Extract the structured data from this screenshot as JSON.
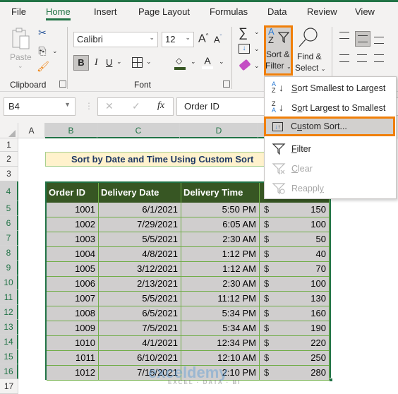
{
  "tabs": [
    {
      "label": "File"
    },
    {
      "label": "Home",
      "active": true
    },
    {
      "label": "Insert"
    },
    {
      "label": "Page Layout"
    },
    {
      "label": "Formulas"
    },
    {
      "label": "Data"
    },
    {
      "label": "Review"
    },
    {
      "label": "View"
    }
  ],
  "ribbon": {
    "clipboard": {
      "paste_label": "Paste",
      "group_label": "Clipboard"
    },
    "font": {
      "font_name": "Calibri",
      "font_size": "12",
      "bold": "B",
      "italic": "I",
      "underline": "U",
      "group_label": "Font",
      "font_color_letter": "A",
      "grow_letter": "A",
      "shrink_letter": "A"
    },
    "editing": {
      "sort_filter_line1": "Sort &",
      "sort_filter_line2": "Filter",
      "find_select_line1": "Find &",
      "find_select_line2": "Select"
    }
  },
  "formula_bar": {
    "name_box": "B4",
    "fx": "fx",
    "content": "Order ID"
  },
  "columns": [
    "A",
    "B",
    "C",
    "D"
  ],
  "rows": [
    "1",
    "2",
    "3",
    "4",
    "5",
    "6",
    "7",
    "8",
    "9",
    "10",
    "11",
    "12",
    "13",
    "14",
    "15",
    "16",
    "17"
  ],
  "sheet": {
    "title": "Sort by Date and Time Using Custom Sort",
    "headers": [
      "Order ID",
      "Delivery Date",
      "Delivery Time"
    ],
    "records": [
      {
        "id": "1001",
        "date": "6/1/2021",
        "time": "5:50 PM",
        "cur": "$",
        "amt": "150"
      },
      {
        "id": "1002",
        "date": "7/29/2021",
        "time": "6:05 AM",
        "cur": "$",
        "amt": "100"
      },
      {
        "id": "1003",
        "date": "5/5/2021",
        "time": "2:30 AM",
        "cur": "$",
        "amt": "50"
      },
      {
        "id": "1004",
        "date": "4/8/2021",
        "time": "1:12 PM",
        "cur": "$",
        "amt": "40"
      },
      {
        "id": "1005",
        "date": "3/12/2021",
        "time": "1:12 AM",
        "cur": "$",
        "amt": "70"
      },
      {
        "id": "1006",
        "date": "2/13/2021",
        "time": "2:30 AM",
        "cur": "$",
        "amt": "100"
      },
      {
        "id": "1007",
        "date": "5/5/2021",
        "time": "11:12 PM",
        "cur": "$",
        "amt": "130"
      },
      {
        "id": "1008",
        "date": "6/5/2021",
        "time": "5:34 PM",
        "cur": "$",
        "amt": "160"
      },
      {
        "id": "1009",
        "date": "7/5/2021",
        "time": "5:34 AM",
        "cur": "$",
        "amt": "190"
      },
      {
        "id": "1010",
        "date": "4/1/2021",
        "time": "12:34 PM",
        "cur": "$",
        "amt": "220"
      },
      {
        "id": "1011",
        "date": "6/10/2021",
        "time": "12:10 AM",
        "cur": "$",
        "amt": "250"
      },
      {
        "id": "1012",
        "date": "7/15/2021",
        "time": "2:10 PM",
        "cur": "$",
        "amt": "280"
      }
    ]
  },
  "sort_menu": {
    "items": [
      {
        "key": "S",
        "rest": "ort Smallest to Largest",
        "icon": "sort-ascending-icon"
      },
      {
        "key_pre": "S",
        "key": "o",
        "rest": "rt Largest to Smallest",
        "icon": "sort-descending-icon"
      },
      {
        "key_pre": "C",
        "key": "u",
        "rest": "stom Sort...",
        "icon": "custom-sort-icon",
        "highlighted": true
      },
      {
        "key": "F",
        "rest": "ilter",
        "icon": "filter-icon"
      },
      {
        "key": "C",
        "rest": "lear",
        "icon": "clear-filter-icon",
        "disabled": true
      },
      {
        "key_pre": "Reappl",
        "key": "y",
        "rest": "",
        "icon": "reapply-filter-icon",
        "disabled": true
      }
    ]
  },
  "watermark": {
    "brand": "exceldemy",
    "tagline": "EXCEL · DATA · BI"
  },
  "colors": {
    "accent": "#217346",
    "highlight_border": "#f07f09",
    "table_header": "#375623",
    "table_cell": "#d0cece",
    "title_fill": "#fff2cc"
  }
}
